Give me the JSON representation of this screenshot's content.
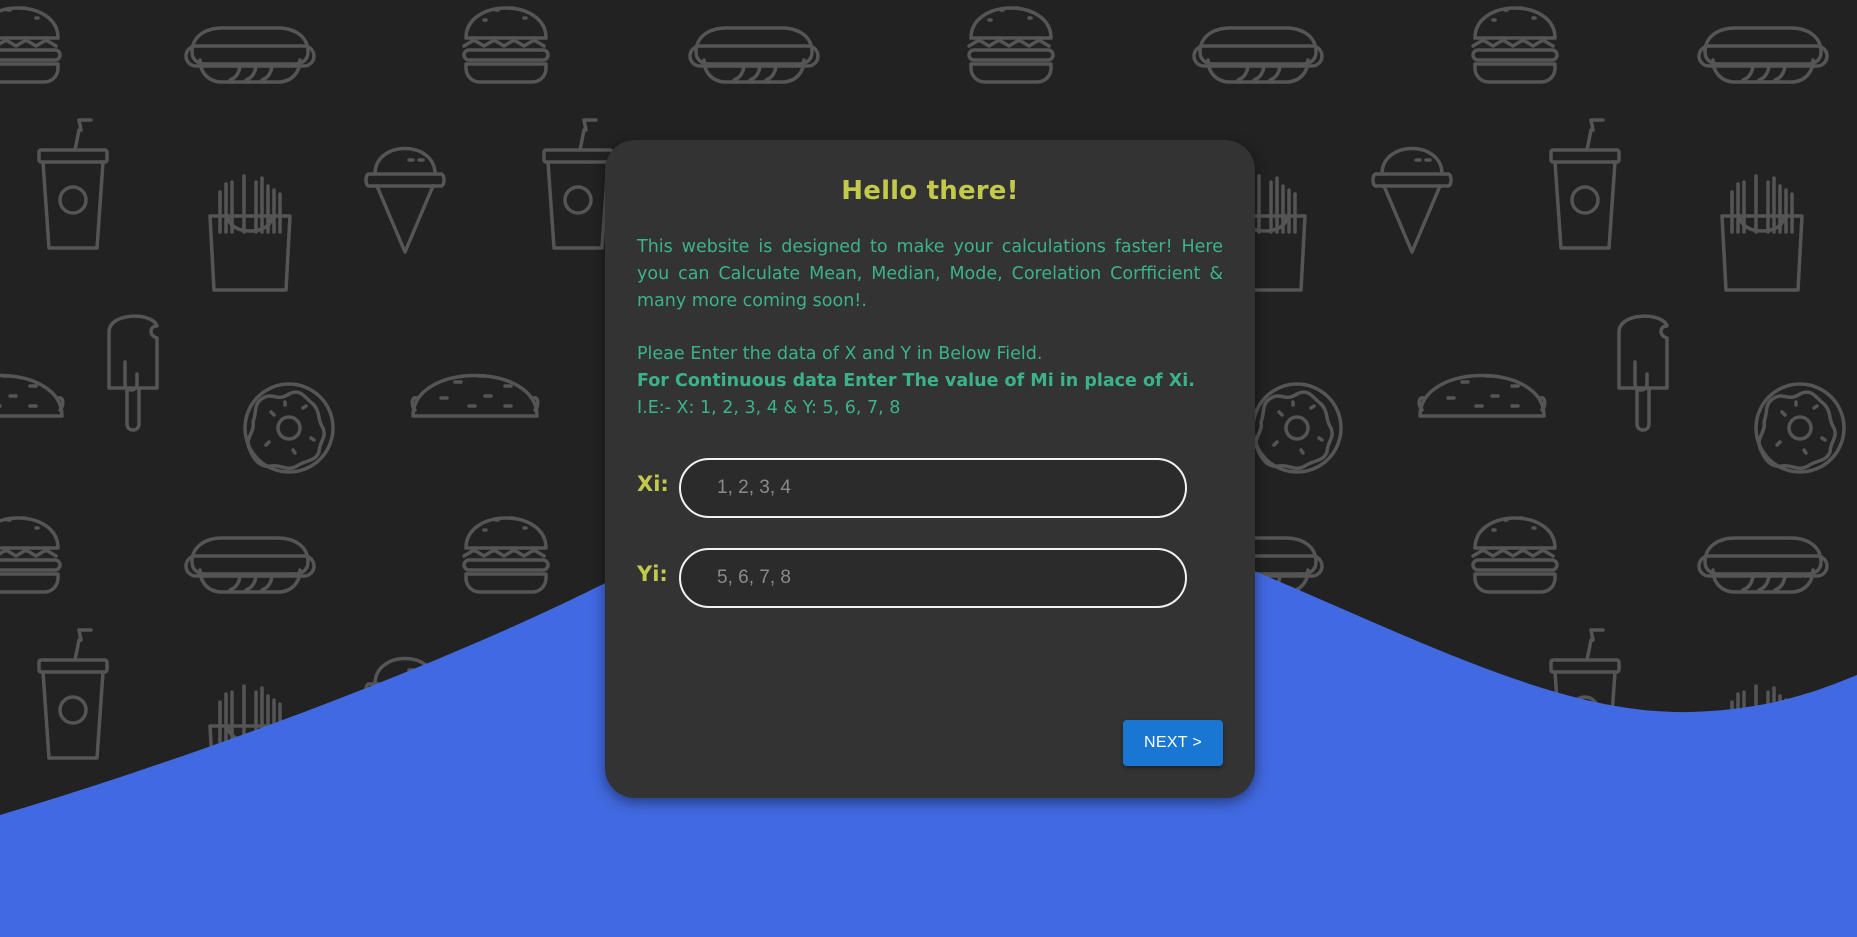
{
  "theme": {
    "background": "#222222",
    "wave": "#4169e1",
    "card": "#333333",
    "title_color": "#c3c94a",
    "text_color": "#3bb38a",
    "button_color": "#1976d2",
    "icon_stroke": "#555555"
  },
  "background_icons": [
    "burger-icon",
    "hotdog-icon",
    "soda-cup-icon",
    "fries-icon",
    "ice-cream-cone-icon",
    "popsicle-icon",
    "donut-icon",
    "taco-icon"
  ],
  "card": {
    "title": "Hello there!",
    "intro": "This website is designed to make your calculations faster! Here you can Calculate Mean, Median, Mode, Corelation Corfficient & many more coming soon!.",
    "instruction_line": "Pleae Enter the data of X and Y in Below Field.",
    "bold_line": "For Continuous data Enter The value of Mi in place of Xi.",
    "example_line": "I.E:- X: 1, 2, 3, 4 & Y: 5, 6, 7, 8"
  },
  "fields": {
    "xi": {
      "label": "Xi:",
      "value": "",
      "placeholder": "1, 2, 3, 4"
    },
    "yi": {
      "label": "Yi:",
      "value": "",
      "placeholder": "5, 6, 7, 8"
    }
  },
  "buttons": {
    "next_label": "NEXT >"
  }
}
